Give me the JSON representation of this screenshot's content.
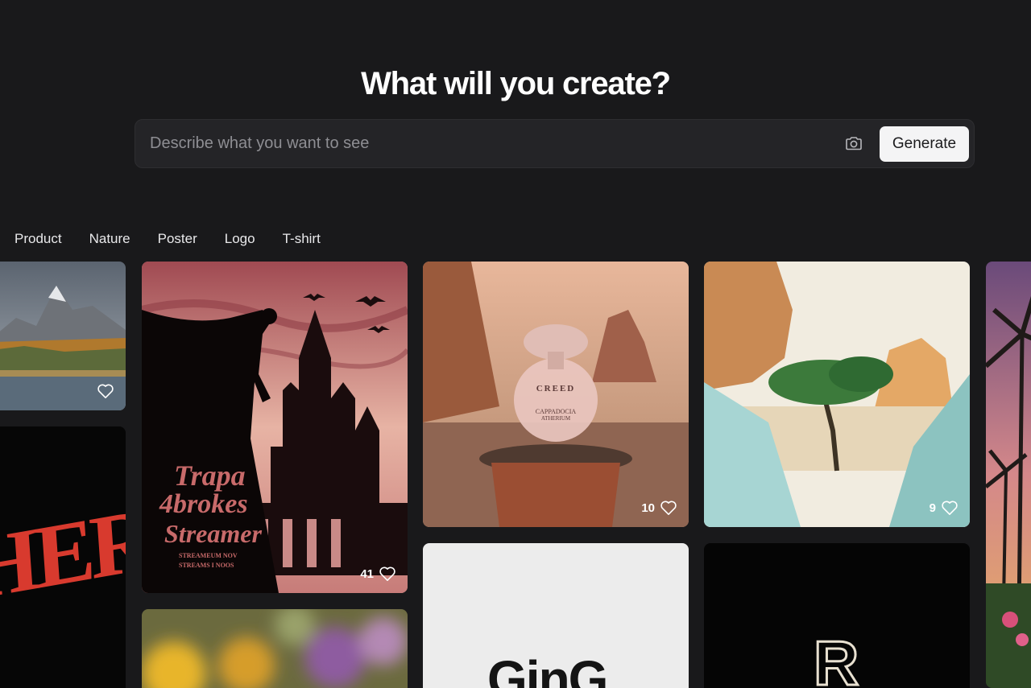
{
  "hero": {
    "title": "What will you create?"
  },
  "prompt": {
    "placeholder": "Describe what you want to see",
    "generate_label": "Generate"
  },
  "categories": [
    "Product",
    "Nature",
    "Poster",
    "Logo",
    "T-shirt"
  ],
  "cards": {
    "mountain": {
      "likes": ""
    },
    "castle": {
      "likes": "41",
      "poster_line1": "Trapa",
      "poster_line2": "4brokes",
      "poster_line3": "Streamer",
      "poster_small1": "STREAMEUM NOV",
      "poster_small2": "STREAMS I NOOS"
    },
    "perfume": {
      "likes": "10",
      "brand": "CREED",
      "name": "CAPPADOCIA",
      "sub": "ATHERIUM"
    },
    "desert": {
      "likes": "9"
    },
    "her": {
      "text": "HER"
    },
    "logo_white": {
      "text": "GinG"
    },
    "logo_black": {
      "text": "R"
    }
  },
  "colors": {
    "background": "#19191b",
    "bar": "#242427",
    "button": "#f4f4f5"
  }
}
